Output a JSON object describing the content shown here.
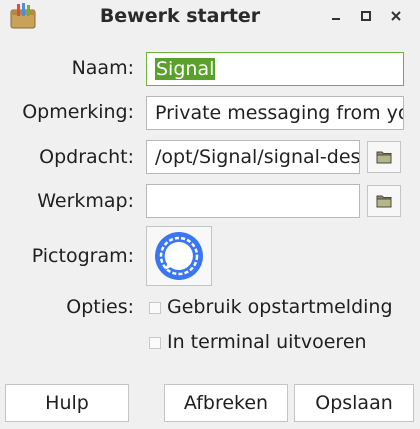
{
  "window": {
    "title": "Bewerk starter",
    "app_icon": "launcher-editor-icon",
    "controls": [
      "minimize-icon",
      "maximize-icon",
      "close-icon"
    ]
  },
  "form": {
    "name_label": "Naam:",
    "name_value": "Signal",
    "comment_label": "Opmerking:",
    "comment_value": "Private messaging from your desktop",
    "command_label": "Opdracht:",
    "command_value": "/opt/Signal/signal-desktop --no-sandbox %U",
    "workdir_label": "Werkmap:",
    "workdir_value": "",
    "icon_label": "Pictogram:",
    "icon_name": "signal-logo-icon",
    "options_label": "Opties:",
    "options": [
      {
        "label": "Gebruik opstartmelding",
        "checked": false
      },
      {
        "label": "In terminal uitvoeren",
        "checked": false
      }
    ],
    "browse_icon": "folder-icon"
  },
  "buttons": {
    "help": "Hulp",
    "cancel": "Afbreken",
    "save": "Opslaan"
  },
  "colors": {
    "selection": "#5aa02c",
    "focus_border": "#6cb23a",
    "signal_blue": "#3a76f0"
  }
}
